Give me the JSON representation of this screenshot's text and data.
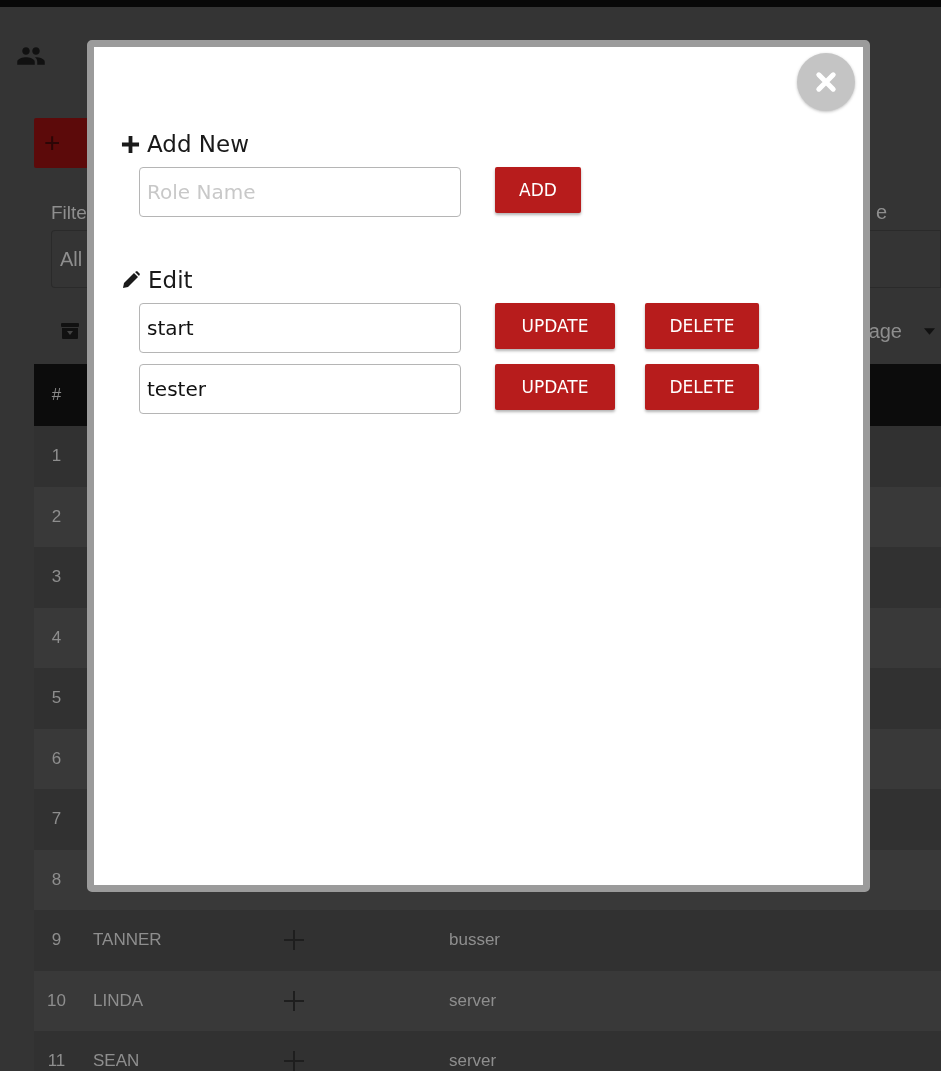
{
  "page": {
    "add_button": "+",
    "filter_label": "Filte",
    "filter_value": "All",
    "right_label": "e",
    "right_column_label": "age",
    "table_header": "#",
    "rows": [
      {
        "number": "1"
      },
      {
        "number": "2"
      },
      {
        "number": "3"
      },
      {
        "number": "4"
      },
      {
        "number": "5"
      },
      {
        "number": "6"
      },
      {
        "number": "7"
      },
      {
        "number": "8"
      },
      {
        "number": "9",
        "name": "TANNER",
        "role": "busser"
      },
      {
        "number": "10",
        "name": "LINDA",
        "role": "server"
      },
      {
        "number": "11",
        "name": "SEAN",
        "role": "server"
      }
    ]
  },
  "modal": {
    "add_section": {
      "title": "Add New",
      "placeholder": "Role Name",
      "button": "ADD"
    },
    "edit_section": {
      "title": "Edit",
      "roles": [
        {
          "value": "start",
          "update": "UPDATE",
          "delete": "DELETE"
        },
        {
          "value": "tester",
          "update": "UPDATE",
          "delete": "DELETE"
        }
      ]
    }
  }
}
